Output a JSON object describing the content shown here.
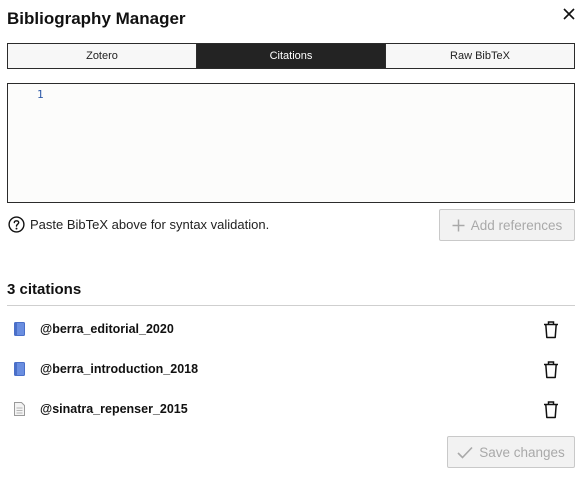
{
  "dialog": {
    "title": "Bibliography Manager"
  },
  "tabs": [
    {
      "label": "Zotero",
      "active": false
    },
    {
      "label": "Citations",
      "active": true
    },
    {
      "label": "Raw BibTeX",
      "active": false
    }
  ],
  "editor": {
    "line_number": "1",
    "content": ""
  },
  "hint": {
    "text": "Paste BibTeX above for syntax validation.",
    "icon": "help-circle-icon"
  },
  "add_button": {
    "label": "Add references",
    "icon": "plus-icon",
    "enabled": false
  },
  "citations": {
    "count_label": "3 citations",
    "items": [
      {
        "key": "@berra_editorial_2020",
        "icon": "book-icon"
      },
      {
        "key": "@berra_introduction_2018",
        "icon": "book-icon"
      },
      {
        "key": "@sinatra_repenser_2015",
        "icon": "document-icon"
      }
    ]
  },
  "save_button": {
    "label": "Save changes",
    "icon": "check-icon",
    "enabled": false
  },
  "colors": {
    "tab_active_bg": "#232323",
    "line_number": "#2e5aa8",
    "book_icon": "#5b7fd6",
    "disabled_text": "#a9a9a9"
  }
}
